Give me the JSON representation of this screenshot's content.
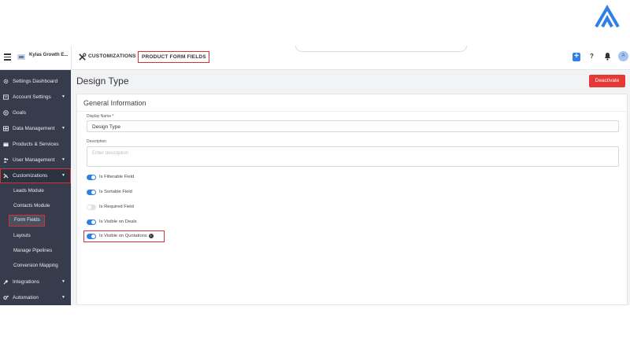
{
  "topbar": {
    "company_name": "Kylas Growth E...",
    "breadcrumb_section": "CUSTOMIZATIONS",
    "breadcrumb_page": "PRODUCT FORM FIELDS",
    "plus_label": "+",
    "help_label": "?",
    "avatar_initial": "A"
  },
  "sidebar": {
    "items": [
      {
        "label": "Settings Dashboard",
        "icon": "gear-icon",
        "expandable": false
      },
      {
        "label": "Account Settings",
        "icon": "account-settings-icon",
        "expandable": true
      },
      {
        "label": "Goals",
        "icon": "target-icon",
        "expandable": false
      },
      {
        "label": "Data Management",
        "icon": "table-icon",
        "expandable": true
      },
      {
        "label": "Products & Services",
        "icon": "box-icon",
        "expandable": false
      },
      {
        "label": "User Management",
        "icon": "users-icon",
        "expandable": true
      },
      {
        "label": "Customizations",
        "icon": "tools-icon",
        "expandable": true
      }
    ],
    "customizations_sub": [
      "Leads Module",
      "Contacts Module",
      "Form Fields",
      "Layouts",
      "Manage Pipelines",
      "Conversion Mapping"
    ],
    "bottom_items": [
      {
        "label": "Integrations",
        "icon": "plug-icon",
        "expandable": true
      },
      {
        "label": "Automation",
        "icon": "gears-icon",
        "expandable": true
      }
    ]
  },
  "main": {
    "title": "Design Type",
    "deactivate_label": "Deactivate",
    "section_title": "General Information",
    "display_name": {
      "label": "Display Name *",
      "value": "Design Type"
    },
    "description": {
      "label": "Description",
      "placeholder": "Enter description"
    },
    "toggles": [
      {
        "label": "Is Filterable Field",
        "on": true
      },
      {
        "label": "Is Sortable Field",
        "on": true
      },
      {
        "label": "Is Required Field",
        "on": false
      },
      {
        "label": "Is Visible on Deals",
        "on": true
      },
      {
        "label": "Is Visible on Quotations",
        "on": true
      }
    ],
    "info_label": "i"
  },
  "colors": {
    "accent": "#2f7fe6",
    "sidebar_bg": "#363c4b",
    "danger": "#e53935",
    "highlight_border": "#d0343a"
  }
}
